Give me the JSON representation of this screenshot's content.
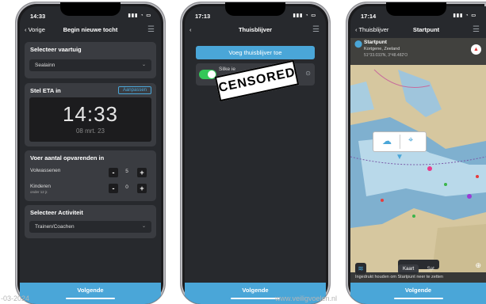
{
  "phone1": {
    "time": "14:33",
    "back_label": "Vorige",
    "title": "Begin nieuwe tocht",
    "vessel_heading": "Selecteer vaartuig",
    "vessel_value": "Sealainn",
    "eta_heading": "Stel ETA in",
    "eta_button": "Aanpassen",
    "eta_time": "14:33",
    "eta_date": "08 mrt. 23",
    "crew_heading": "Voer aantal opvarenden in",
    "adults_label": "Volwassenen",
    "adults_value": "5",
    "children_label": "Kinderen",
    "children_sublabel": "onder 12 jr.",
    "children_value": "0",
    "activity_heading": "Selecteer Activiteit",
    "activity_value": "Trainen/Coachen",
    "next_button": "Volgende"
  },
  "phone2": {
    "time": "17:13",
    "title": "Thuisblijver",
    "add_button": "Voeg thuisblijver toe",
    "contact_name": "Silke ie",
    "censored_label": "CENSORED",
    "next_button": "Volgende"
  },
  "phone3": {
    "time": "17:14",
    "back_label": "Thuisblijver",
    "title": "Startpunt",
    "location_label": "Startpunt",
    "location_place": "Kortgene, Zeeland",
    "location_coords": "51°33.033'N, 3°48.482'O",
    "map_tab": "Kaart",
    "sat_tab": "Sat",
    "hint": "Ingedrukt houden om Startpunt neer te zetten",
    "next_button": "Volgende"
  },
  "watermark_left": "-03-2024",
  "watermark_right": "www.veiligvoelen.nl",
  "colors": {
    "accent": "#4aa6d8",
    "card": "#3a3c41",
    "toggle_on": "#34c759"
  }
}
